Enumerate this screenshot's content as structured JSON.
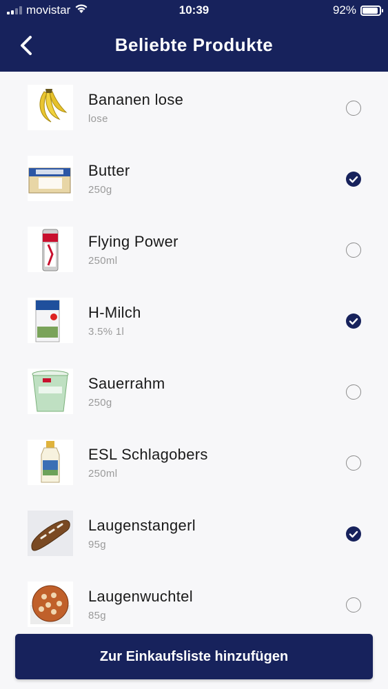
{
  "status_bar": {
    "carrier": "movistar",
    "time": "10:39",
    "battery_percent": "92%",
    "battery_level": 0.92,
    "signal_bars": 2
  },
  "nav": {
    "title": "Beliebte Produkte",
    "back_icon": "chevron-left-icon"
  },
  "products": [
    {
      "name": "Bananen lose",
      "detail": "lose",
      "selected": false,
      "image": "bananas"
    },
    {
      "name": "Butter",
      "detail": "250g",
      "selected": true,
      "image": "butter-pack"
    },
    {
      "name": "Flying Power",
      "detail": "250ml",
      "selected": false,
      "image": "energy-drink-can"
    },
    {
      "name": "H-Milch",
      "detail": "3.5% 1l",
      "selected": true,
      "image": "milk-carton"
    },
    {
      "name": "Sauerrahm",
      "detail": "250g",
      "selected": false,
      "image": "sour-cream-cup"
    },
    {
      "name": "ESL Schlagobers",
      "detail": "250ml",
      "selected": false,
      "image": "cream-bottle"
    },
    {
      "name": "Laugenstangerl",
      "detail": "95g",
      "selected": true,
      "image": "pretzel-stick"
    },
    {
      "name": "Laugenwuchtel",
      "detail": "85g",
      "selected": false,
      "image": "pretzel-roll"
    }
  ],
  "footer": {
    "add_button_label": "Zur Einkaufsliste hinzufügen"
  },
  "colors": {
    "primary": "#17225c",
    "background": "#f7f7f9",
    "secondary_text": "#9a9a9a"
  }
}
